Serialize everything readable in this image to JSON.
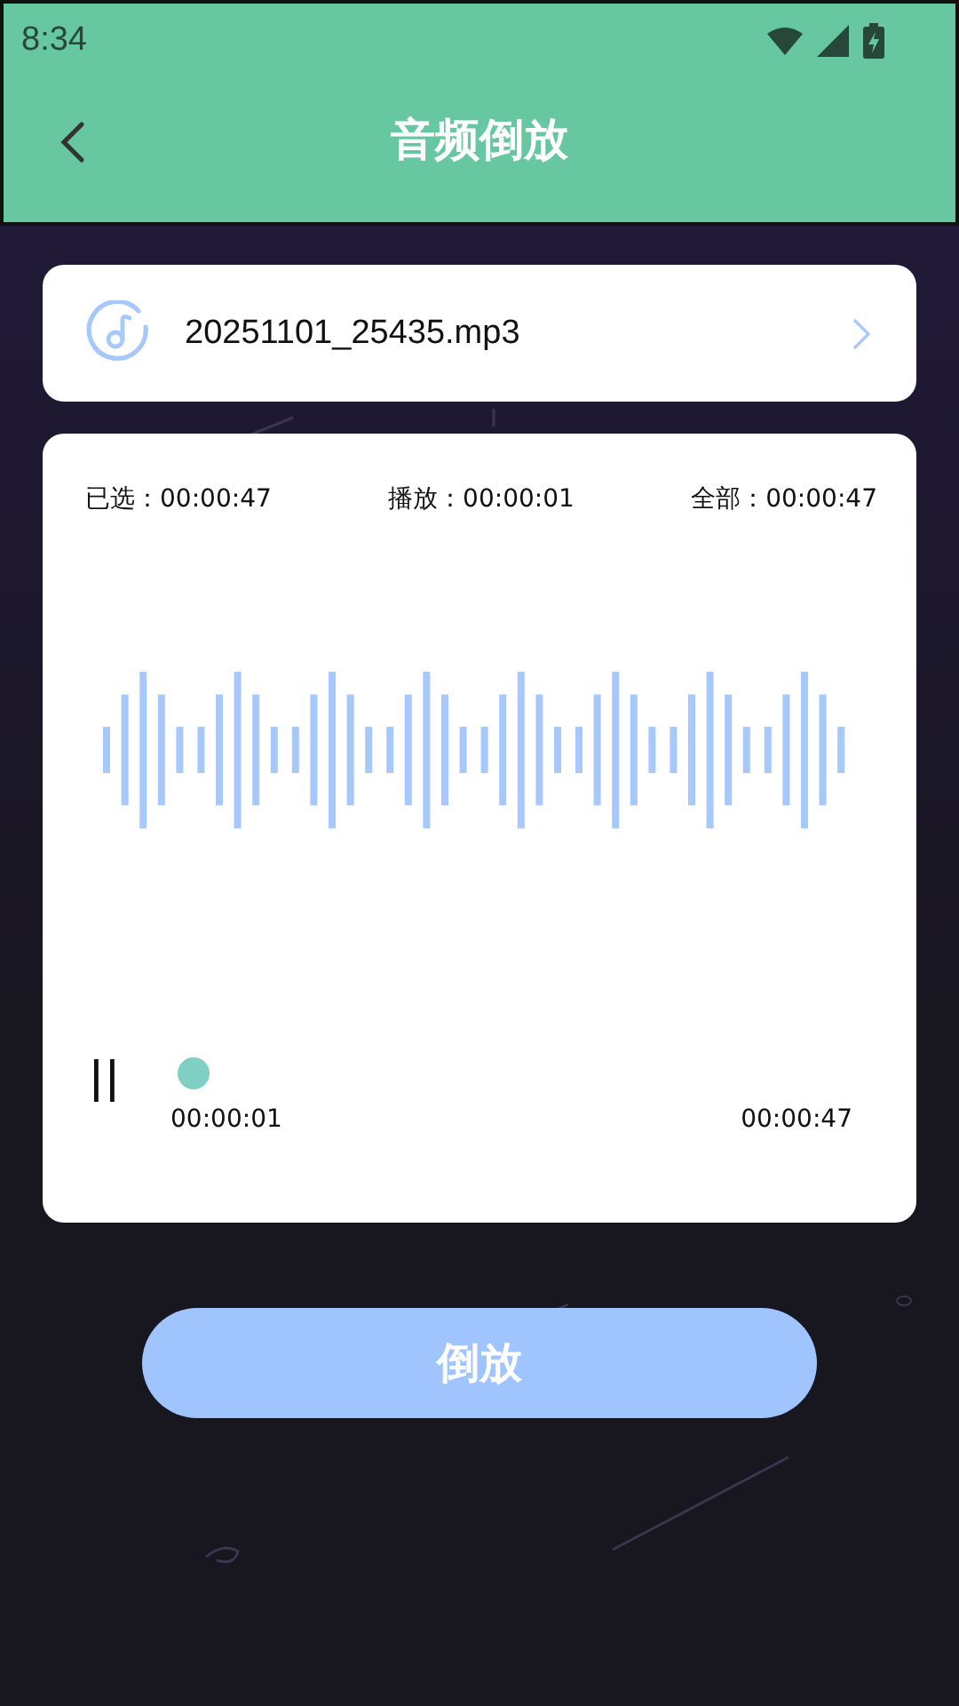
{
  "status_bar": {
    "time": "8:34"
  },
  "header": {
    "title": "音频倒放"
  },
  "file": {
    "name": "20251101_25435.mp3"
  },
  "info": [
    {
      "label": "已选：00:00:47"
    },
    {
      "label": "播放：00:00:01"
    },
    {
      "label": "全部：00:00:47"
    }
  ],
  "player": {
    "playing": true,
    "current": "00:00:01",
    "total": "00:00:47"
  },
  "action_button": {
    "label": "倒放"
  }
}
